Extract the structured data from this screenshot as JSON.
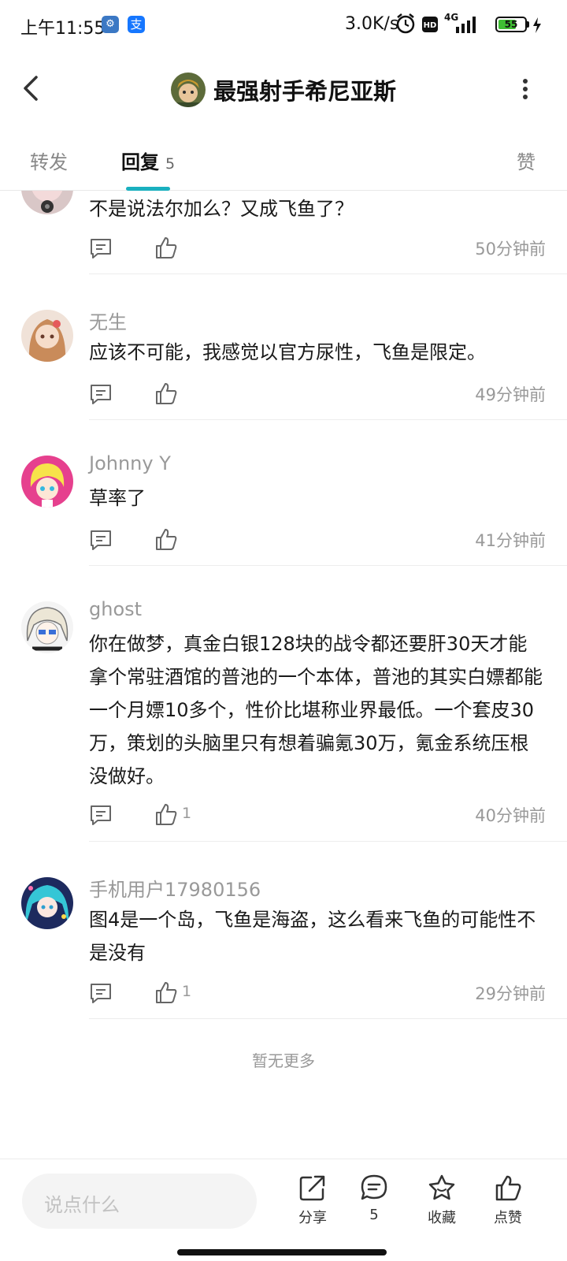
{
  "status_bar": {
    "time": "上午11:55",
    "alipay_glyph": "支",
    "network_speed": "3.0K/s",
    "network_type": "4G",
    "hd_badge": "HD",
    "battery_level": "55",
    "icons": [
      "settings-app-icon",
      "alipay-icon",
      "alarm-icon",
      "hd-icon",
      "signal-icon",
      "battery-icon",
      "charging-icon"
    ]
  },
  "header": {
    "title": "最强射手希尼亚斯",
    "icons": [
      "back-icon",
      "more-icon"
    ]
  },
  "tabs": {
    "forward": "转发",
    "reply": "回复",
    "reply_count": "5",
    "like": "赞"
  },
  "comments": [
    {
      "name": "",
      "text": "不是说法尔加么？又成飞鱼了？",
      "likes": "",
      "time": "50分钟前"
    },
    {
      "name": "无生",
      "text": "应该不可能，我感觉以官方尿性，飞鱼是限定。",
      "likes": "",
      "time": "49分钟前"
    },
    {
      "name": "Johnny Y",
      "text": "草率了",
      "likes": "",
      "time": "41分钟前"
    },
    {
      "name": "ghost",
      "text": "你在做梦，真金白银128块的战令都还要肝30天才能拿个常驻酒馆的普池的一个本体，普池的其实白嫖都能一个月嫖10多个，性价比堪称业界最低。一个套皮30万，策划的头脑里只有想着骗氪30万，氪金系统压根没做好。",
      "likes": "1",
      "time": "40分钟前"
    },
    {
      "name": "手机用户17980156",
      "text": "图4是一个岛，飞鱼是海盗，这么看来飞鱼的可能性不是没有",
      "likes": "1",
      "time": "29分钟前"
    }
  ],
  "no_more": "暂无更多",
  "bottom_bar": {
    "input_placeholder": "说点什么",
    "share_label": "分享",
    "comment_count": "5",
    "favorite_label": "收藏",
    "like_label": "点赞"
  },
  "colors": {
    "accent": "#1ab0bf",
    "muted_text": "#999999",
    "body_text": "#1a1a1a"
  }
}
